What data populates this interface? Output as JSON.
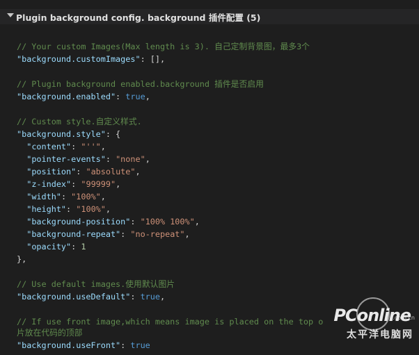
{
  "header": {
    "title": "Plugin background config. background 插件配置 (5)"
  },
  "code": {
    "l1": "// Your custom Images(Max length is 3). 自己定制背景图，最多3个",
    "l2_key": "\"background.customImages\"",
    "l2_rest": ": [],",
    "l4": "// Plugin background enabled.background 插件是否启用",
    "l5_key": "\"background.enabled\"",
    "l5_colon": ": ",
    "l5_val": "true",
    "l5_end": ",",
    "l7": "// Custom style.自定义样式.",
    "l8_key": "\"background.style\"",
    "l8_rest": ": {",
    "props": [
      {
        "key": "\"content\"",
        "value": "\"''\"",
        "end": ","
      },
      {
        "key": "\"pointer-events\"",
        "value": "\"none\"",
        "end": ","
      },
      {
        "key": "\"position\"",
        "value": "\"absolute\"",
        "end": ","
      },
      {
        "key": "\"z-index\"",
        "value": "\"99999\"",
        "end": ","
      },
      {
        "key": "\"width\"",
        "value": "\"100%\"",
        "end": ","
      },
      {
        "key": "\"height\"",
        "value": "\"100%\"",
        "end": ","
      },
      {
        "key": "\"background-position\"",
        "value": "\"100% 100%\"",
        "end": ","
      },
      {
        "key": "\"background-repeat\"",
        "value": "\"no-repeat\"",
        "end": ","
      },
      {
        "key": "\"opacity\"",
        "value": "1",
        "end": ""
      }
    ],
    "l18": "},",
    "l20": "// Use default images.使用默认图片",
    "l21_key": "\"background.useDefault\"",
    "l21_colon": ": ",
    "l21_val": "true",
    "l21_end": ",",
    "l23": "// If use front image,which means image is placed on the top o",
    "l24": "片放在代码的顶部",
    "l25_key": "\"background.useFront\"",
    "l25_colon": ": ",
    "l25_val": "true"
  },
  "watermark": {
    "logo": "PConline",
    "suffix": ".com.cn",
    "cn": "太平洋电脑网"
  }
}
